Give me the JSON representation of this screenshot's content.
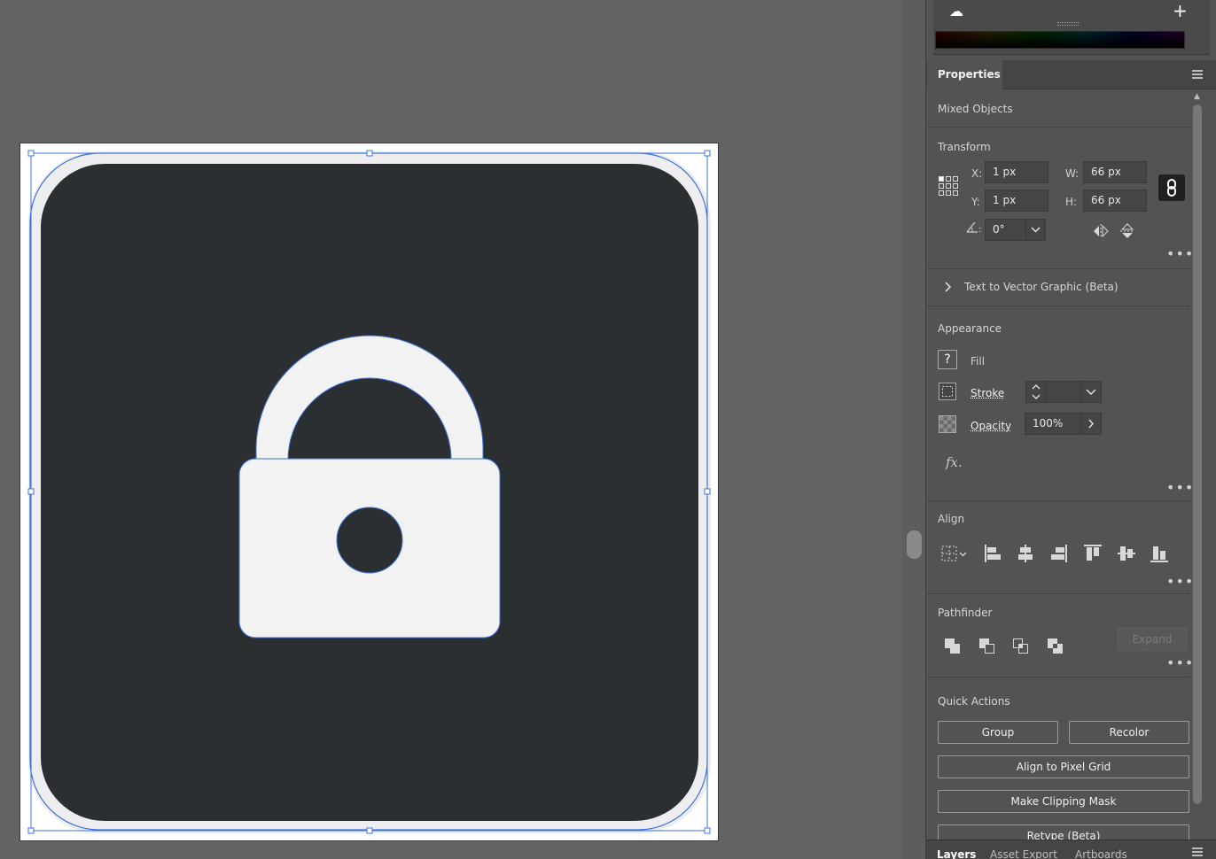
{
  "panel": {
    "tab_properties": "Properties",
    "selection_type": "Mixed Objects",
    "transform": {
      "title": "Transform",
      "x_label": "X:",
      "x_value": "1 px",
      "y_label": "Y:",
      "y_value": "1 px",
      "w_label": "W:",
      "w_value": "66 px",
      "h_label": "H:",
      "h_value": "66 px",
      "angle_value": "0°"
    },
    "text_to_vector": "Text to Vector Graphic (Beta)",
    "appearance": {
      "title": "Appearance",
      "fill_label": "Fill",
      "fill_swatch": "?",
      "stroke_label": "Stroke",
      "opacity_label": "Opacity",
      "opacity_value": "100%",
      "fx_label": "fx."
    },
    "align": {
      "title": "Align"
    },
    "pathfinder": {
      "title": "Pathfinder",
      "expand_label": "Expand"
    },
    "quick_actions": {
      "title": "Quick Actions",
      "group_label": "Group",
      "recolor_label": "Recolor",
      "align_pixel_grid_label": "Align to Pixel Grid",
      "make_clipping_mask_label": "Make Clipping Mask",
      "retype_label": "Retype (Beta)"
    },
    "bottom_tabs": [
      "Layers",
      "Asset Export",
      "Artboards"
    ]
  },
  "colors": {
    "icon_background": "#2b2f31",
    "icon_foreground": "#f2f2f3",
    "selection": "#3b73e0"
  }
}
